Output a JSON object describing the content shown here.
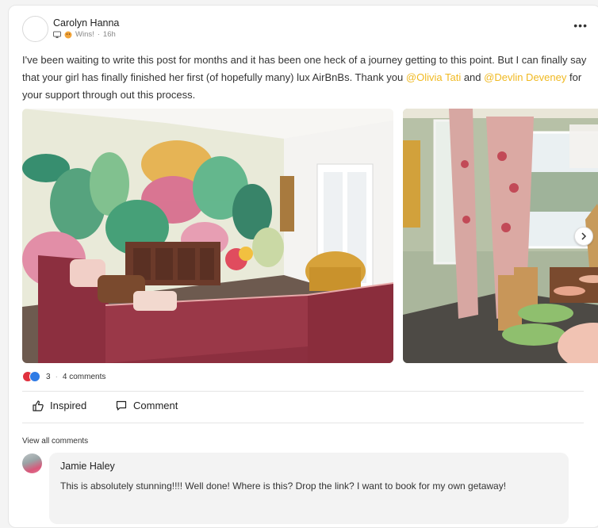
{
  "post": {
    "author": "Carolyn Hanna",
    "category": "Wins!",
    "time": "16h",
    "more": "•••",
    "text_part1": "I've been waiting to write this post for months and it has been one heck of a journey getting to this point. But I can finally say that your girl has finally finished her first (of hopefully many) lux AirBnBs. Thank you ",
    "mention1": "@Olivia Tati",
    "text_part2": " and ",
    "mention2": "@Devlin Deveney",
    "text_part3": " for your support through out this process."
  },
  "stats": {
    "reaction_count": "3",
    "separator": "·",
    "comments_label": "4 comments"
  },
  "actions": {
    "inspired_label": "Inspired",
    "comment_label": "Comment"
  },
  "comments": {
    "view_all": "View all comments",
    "items": [
      {
        "name": "Jamie Haley",
        "text": "This is absolutely stunning!!!! Well done! Where is this? Drop the link? I want to book for my own getaway!"
      }
    ]
  },
  "icons": {
    "more": "more-horizontal-icon",
    "next": "chevron-right-icon",
    "inspired": "thumbs-up-icon",
    "comment": "speech-bubble-icon"
  },
  "colors": {
    "mention": "#f0b921",
    "heart": "#e0313e",
    "like": "#2f7be5"
  }
}
